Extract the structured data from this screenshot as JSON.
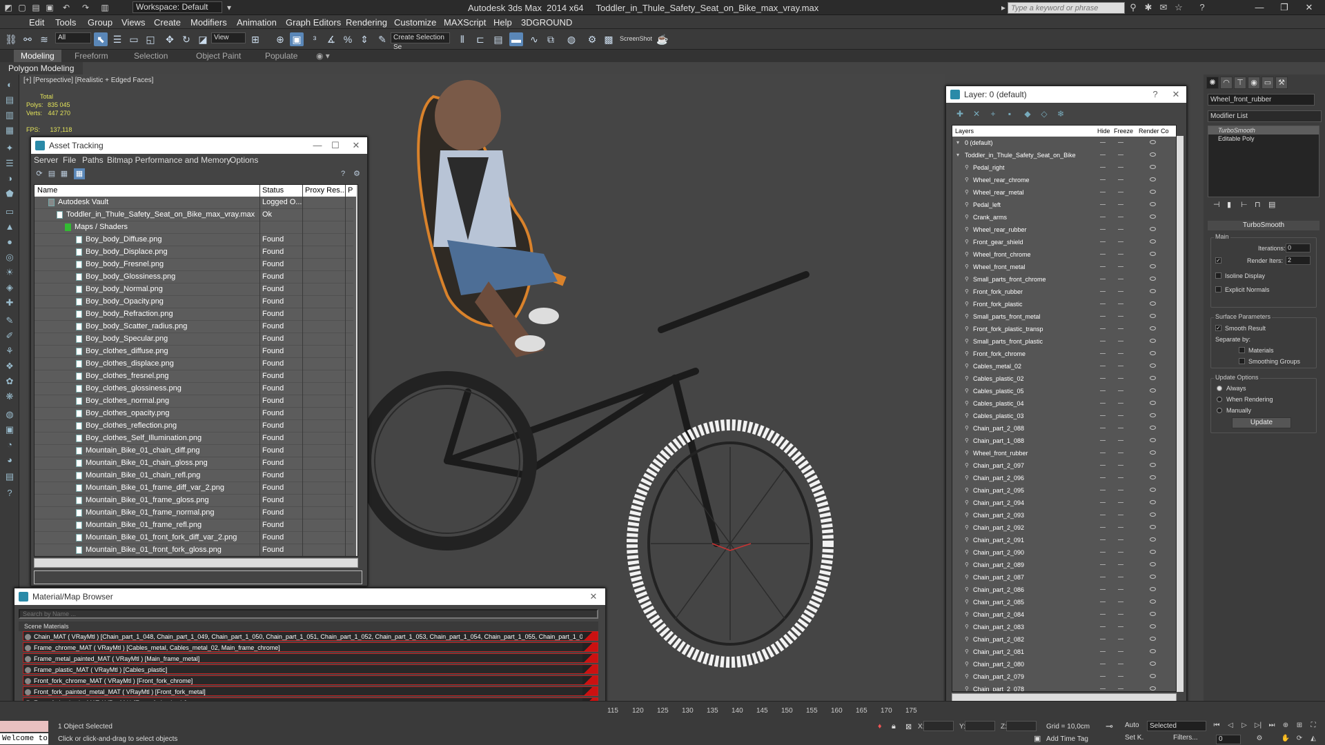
{
  "app": {
    "title": "Autodesk 3ds Max  2014 x64     Toddler_in_Thule_Safety_Seat_on_Bike_max_vray.max",
    "workspace": "Workspace: Default",
    "search_placeholder": "Type a keyword or phrase"
  },
  "menu": [
    "Edit",
    "Tools",
    "Group",
    "Views",
    "Create",
    "Modifiers",
    "Animation",
    "Graph Editors",
    "Rendering",
    "Customize",
    "MAXScript",
    "Help",
    "3DGROUND"
  ],
  "toolbar": {
    "filter_dropdown": "All",
    "refcoord_dropdown": "View",
    "selection_set_dropdown": "Create Selection Se",
    "screenshot_label": "ScreenShot"
  },
  "ribbon": {
    "tabs": [
      "Modeling",
      "Freeform",
      "Selection",
      "Object Paint",
      "Populate"
    ],
    "active_tab": "Modeling",
    "subpanel": "Polygon Modeling"
  },
  "viewport": {
    "label": "[+] [Perspective] [Realistic + Edged Faces]",
    "stats": {
      "header": "Total",
      "polys_label": "Polys:",
      "polys": "835 045",
      "verts_label": "Verts:",
      "verts": "447 270",
      "fps_label": "FPS:",
      "fps": "137,118"
    }
  },
  "asset_tracking": {
    "title": "Asset Tracking",
    "menu": [
      "Server",
      "File",
      "Paths",
      "Bitmap Performance and Memory",
      "Options"
    ],
    "columns": [
      "Name",
      "Status",
      "Proxy Res...",
      "P"
    ],
    "rows": [
      {
        "name": "Autodesk Vault",
        "status": "Logged O...",
        "level": 1
      },
      {
        "name": "Toddler_in_Thule_Safety_Seat_on_Bike_max_vray.max",
        "status": "Ok",
        "level": 2
      },
      {
        "name": "Maps / Shaders",
        "status": "",
        "level": 3
      },
      {
        "name": "Boy_body_Diffuse.png",
        "status": "Found",
        "level": 4
      },
      {
        "name": "Boy_body_Displace.png",
        "status": "Found",
        "level": 4
      },
      {
        "name": "Boy_body_Fresnel.png",
        "status": "Found",
        "level": 4
      },
      {
        "name": "Boy_body_Glossiness.png",
        "status": "Found",
        "level": 4
      },
      {
        "name": "Boy_body_Normal.png",
        "status": "Found",
        "level": 4
      },
      {
        "name": "Boy_body_Opacity.png",
        "status": "Found",
        "level": 4
      },
      {
        "name": "Boy_body_Refraction.png",
        "status": "Found",
        "level": 4
      },
      {
        "name": "Boy_body_Scatter_radius.png",
        "status": "Found",
        "level": 4
      },
      {
        "name": "Boy_body_Specular.png",
        "status": "Found",
        "level": 4
      },
      {
        "name": "Boy_clothes_diffuse.png",
        "status": "Found",
        "level": 4
      },
      {
        "name": "Boy_clothes_displace.png",
        "status": "Found",
        "level": 4
      },
      {
        "name": "Boy_clothes_fresnel.png",
        "status": "Found",
        "level": 4
      },
      {
        "name": "Boy_clothes_glossiness.png",
        "status": "Found",
        "level": 4
      },
      {
        "name": "Boy_clothes_normal.png",
        "status": "Found",
        "level": 4
      },
      {
        "name": "Boy_clothes_opacity.png",
        "status": "Found",
        "level": 4
      },
      {
        "name": "Boy_clothes_reflection.png",
        "status": "Found",
        "level": 4
      },
      {
        "name": "Boy_clothes_Self_Illumination.png",
        "status": "Found",
        "level": 4
      },
      {
        "name": "Mountain_Bike_01_chain_diff.png",
        "status": "Found",
        "level": 4
      },
      {
        "name": "Mountain_Bike_01_chain_gloss.png",
        "status": "Found",
        "level": 4
      },
      {
        "name": "Mountain_Bike_01_chain_refl.png",
        "status": "Found",
        "level": 4
      },
      {
        "name": "Mountain_Bike_01_frame_diff_var_2.png",
        "status": "Found",
        "level": 4
      },
      {
        "name": "Mountain_Bike_01_frame_gloss.png",
        "status": "Found",
        "level": 4
      },
      {
        "name": "Mountain_Bike_01_frame_normal.png",
        "status": "Found",
        "level": 4
      },
      {
        "name": "Mountain_Bike_01_frame_refl.png",
        "status": "Found",
        "level": 4
      },
      {
        "name": "Mountain_Bike_01_front_fork_diff_var_2.png",
        "status": "Found",
        "level": 4
      },
      {
        "name": "Mountain_Bike_01_front_fork_gloss.png",
        "status": "Found",
        "level": 4
      }
    ]
  },
  "material_browser": {
    "title": "Material/Map Browser",
    "search_placeholder": "Search by Name ...",
    "group": "Scene Materials",
    "rows": [
      "Chain_MAT  ( VRayMtl )  [Chain_part_1_048, Chain_part_1_049, Chain_part_1_050, Chain_part_1_051, Chain_part_1_052, Chain_part_1_053, Chain_part_1_054, Chain_part_1_055, Chain_part_1_056, Chain_part...",
      "Frame_chrome_MAT  ( VRayMtl )  [Cables_metal, Cables_metal_02, Main_frame_chrome]",
      "Frame_metal_painted_MAT  ( VRayMtl )  [Main_frame_metal]",
      "Frame_plastic_MAT  ( VRayMtl )  [Cables_plastic]",
      "Front_fork_chrome_MAT  ( VRayMtl )  [Front_fork_chrome]",
      "Front_fork_painted_metal_MAT  ( VRayMtl )  [Front_fork_metal]",
      "Front_fork_plastic_MAT  ( VRayMtl )  [Front_fork_plastic]"
    ]
  },
  "layer_explorer": {
    "title": "Layer: 0 (default)",
    "columns": [
      "Layers",
      "Hide",
      "Freeze",
      "Render",
      "Co"
    ],
    "rows": [
      {
        "name": "0 (default)",
        "level": 0
      },
      {
        "name": "Toddler_in_Thule_Safety_Seat_on_Bike",
        "level": 0
      },
      {
        "name": "Pedal_right",
        "level": 1
      },
      {
        "name": "Wheel_rear_chrome",
        "level": 1
      },
      {
        "name": "Wheel_rear_metal",
        "level": 1
      },
      {
        "name": "Pedal_left",
        "level": 1
      },
      {
        "name": "Crank_arms",
        "level": 1
      },
      {
        "name": "Wheel_rear_rubber",
        "level": 1
      },
      {
        "name": "Front_gear_shield",
        "level": 1
      },
      {
        "name": "Wheel_front_chrome",
        "level": 1
      },
      {
        "name": "Wheel_front_metal",
        "level": 1
      },
      {
        "name": "Small_parts_front_chrome",
        "level": 1
      },
      {
        "name": "Front_fork_rubber",
        "level": 1
      },
      {
        "name": "Front_fork_plastic",
        "level": 1
      },
      {
        "name": "Small_parts_front_metal",
        "level": 1
      },
      {
        "name": "Front_fork_plastic_transp",
        "level": 1
      },
      {
        "name": "Small_parts_front_plastic",
        "level": 1
      },
      {
        "name": "Front_fork_chrome",
        "level": 1
      },
      {
        "name": "Cables_metal_02",
        "level": 1
      },
      {
        "name": "Cables_plastic_02",
        "level": 1
      },
      {
        "name": "Cables_plastic_05",
        "level": 1
      },
      {
        "name": "Cables_plastic_04",
        "level": 1
      },
      {
        "name": "Cables_plastic_03",
        "level": 1
      },
      {
        "name": "Chain_part_2_088",
        "level": 1
      },
      {
        "name": "Chain_part_1_088",
        "level": 1
      },
      {
        "name": "Wheel_front_rubber",
        "level": 1
      },
      {
        "name": "Chain_part_2_097",
        "level": 1
      },
      {
        "name": "Chain_part_2_096",
        "level": 1
      },
      {
        "name": "Chain_part_2_095",
        "level": 1
      },
      {
        "name": "Chain_part_2_094",
        "level": 1
      },
      {
        "name": "Chain_part_2_093",
        "level": 1
      },
      {
        "name": "Chain_part_2_092",
        "level": 1
      },
      {
        "name": "Chain_part_2_091",
        "level": 1
      },
      {
        "name": "Chain_part_2_090",
        "level": 1
      },
      {
        "name": "Chain_part_2_089",
        "level": 1
      },
      {
        "name": "Chain_part_2_087",
        "level": 1
      },
      {
        "name": "Chain_part_2_086",
        "level": 1
      },
      {
        "name": "Chain_part_2_085",
        "level": 1
      },
      {
        "name": "Chain_part_2_084",
        "level": 1
      },
      {
        "name": "Chain_part_2_083",
        "level": 1
      },
      {
        "name": "Chain_part_2_082",
        "level": 1
      },
      {
        "name": "Chain_part_2_081",
        "level": 1
      },
      {
        "name": "Chain_part_2_080",
        "level": 1
      },
      {
        "name": "Chain_part_2_079",
        "level": 1
      },
      {
        "name": "Chain_part_2_078",
        "level": 1
      }
    ]
  },
  "command_panel": {
    "object_name": "Wheel_front_rubber",
    "modifier_list": "Modifier List",
    "stack": [
      "TurboSmooth",
      "Editable Poly"
    ],
    "rollout": "TurboSmooth",
    "main_group": "Main",
    "iterations_label": "Iterations:",
    "iterations": "0",
    "render_iters_label": "Render Iters:",
    "render_iters": "2",
    "render_iters_checked": true,
    "isoline_label": "Isoline Display",
    "explicit_normals_label": "Explicit Normals",
    "surface_group": "Surface Parameters",
    "smooth_result_label": "Smooth Result",
    "smooth_result_checked": true,
    "separate_by_label": "Separate by:",
    "materials_label": "Materials",
    "smoothing_groups_label": "Smoothing Groups",
    "update_group": "Update Options",
    "update_options": [
      "Always",
      "When Rendering",
      "Manually"
    ],
    "update_selected": "Always",
    "update_button": "Update"
  },
  "status": {
    "maxscript_listener": "Welcome to",
    "selection": "1 Object Selected",
    "prompt": "Click or click-and-drag to select objects",
    "x_label": "X:",
    "y_label": "Y:",
    "z_label": "Z:",
    "grid": "Grid = 10,0cm",
    "add_time_tag": "Add Time Tag",
    "auto_key": "Auto",
    "set_key": "Set K.",
    "selected_dropdown": "Selected",
    "filters": "Filters...",
    "frame": "0",
    "timeline_ticks": [
      "115",
      "120",
      "125",
      "130",
      "135",
      "140",
      "145",
      "150",
      "155",
      "160",
      "165",
      "170",
      "175"
    ]
  },
  "colors": {
    "accent": "#5a87b8",
    "wire_orange": "#d9822b",
    "stats_yellow": "#e4e45a"
  }
}
